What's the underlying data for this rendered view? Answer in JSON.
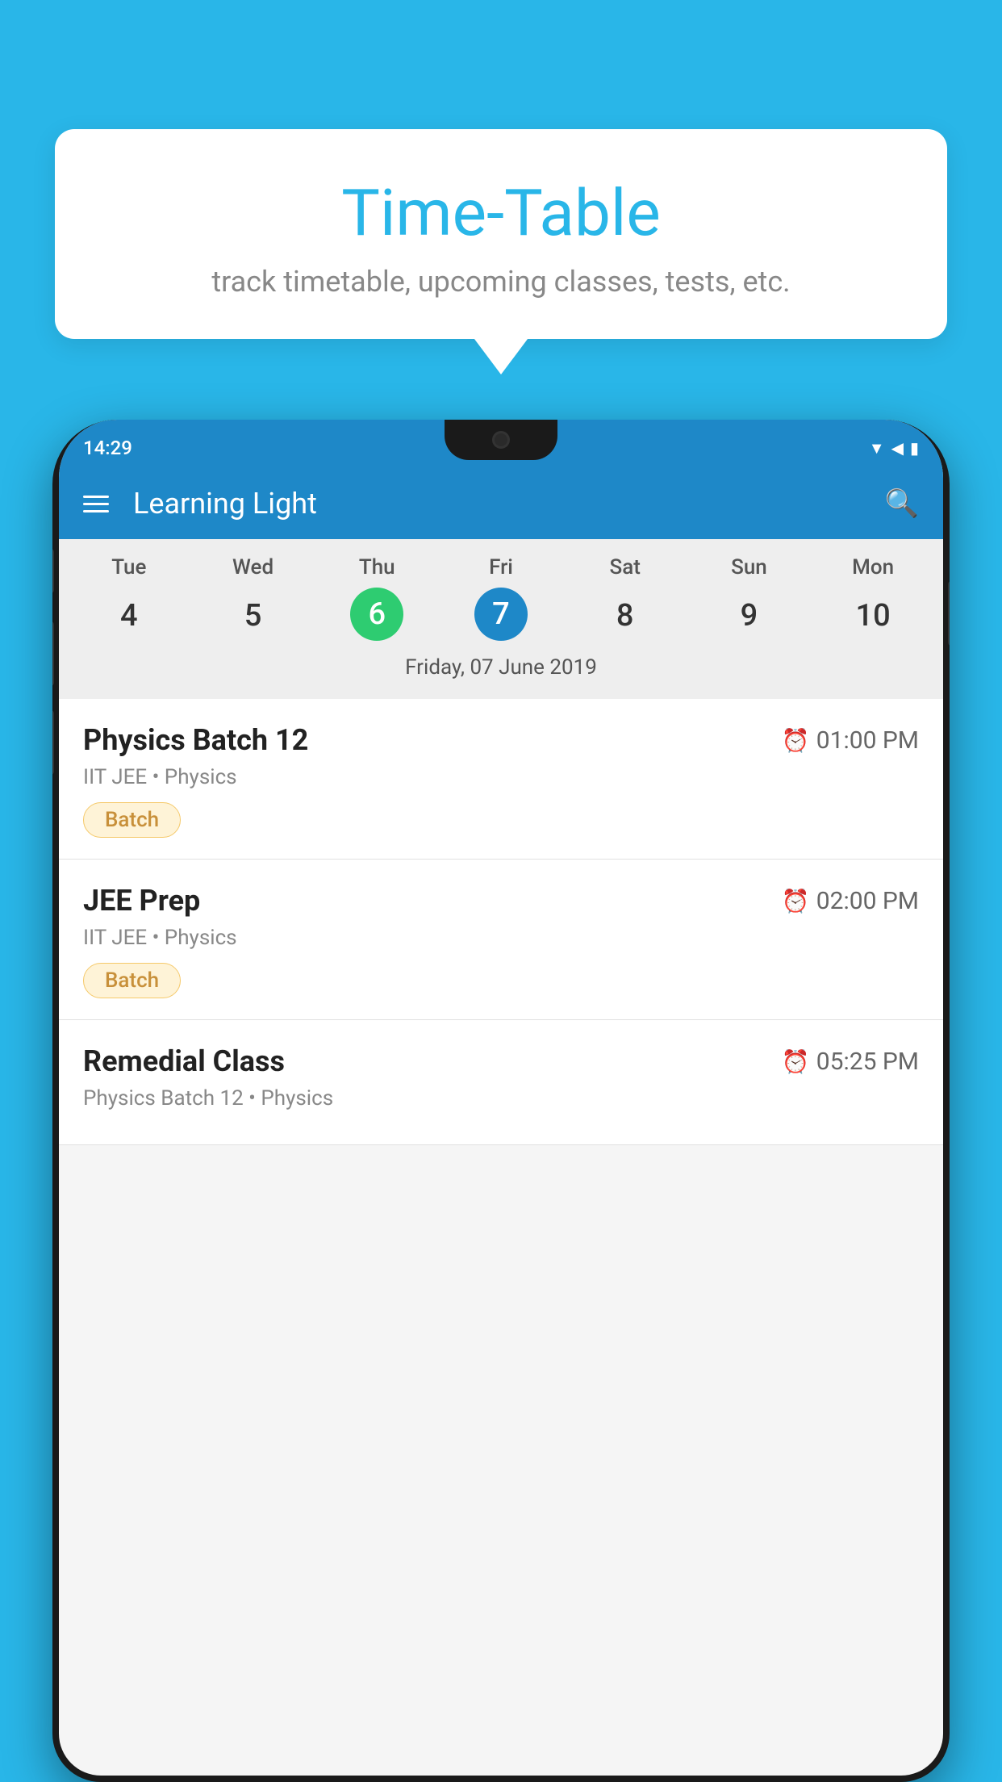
{
  "background_color": "#29b6e8",
  "tooltip": {
    "title": "Time-Table",
    "subtitle": "track timetable, upcoming classes, tests, etc."
  },
  "phone": {
    "status_bar": {
      "time": "14:29"
    },
    "app_bar": {
      "title": "Learning Light"
    },
    "calendar": {
      "days": [
        "Tue",
        "Wed",
        "Thu",
        "Fri",
        "Sat",
        "Sun",
        "Mon"
      ],
      "dates": [
        "4",
        "5",
        "6",
        "7",
        "8",
        "9",
        "10"
      ],
      "today_index": 2,
      "selected_index": 3,
      "selected_date_label": "Friday, 07 June 2019"
    },
    "schedule": [
      {
        "title": "Physics Batch 12",
        "time": "01:00 PM",
        "meta": "IIT JEE • Physics",
        "badge": "Batch"
      },
      {
        "title": "JEE Prep",
        "time": "02:00 PM",
        "meta": "IIT JEE • Physics",
        "badge": "Batch"
      },
      {
        "title": "Remedial Class",
        "time": "05:25 PM",
        "meta": "Physics Batch 12 • Physics",
        "badge": null
      }
    ]
  }
}
